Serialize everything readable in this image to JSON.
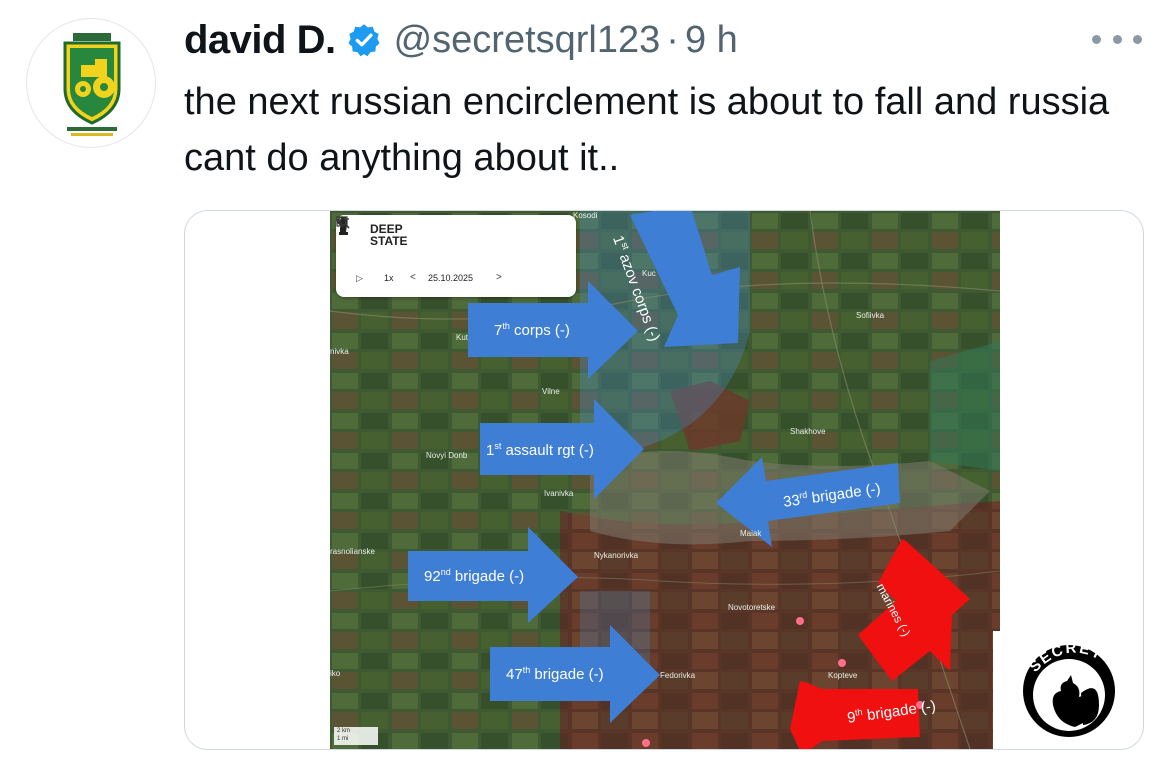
{
  "tweet": {
    "author_name": "david D.",
    "handle": "@secretsqrl123",
    "separator": "·",
    "time": "9 h",
    "text": "the next russian encirclement is about to fall and russia cant do anything about it..",
    "avatar_icon": "tractor-shield-icon",
    "verified_icon": "verified-badge-icon",
    "more_icon": "more-dots-icon"
  },
  "map": {
    "panel": {
      "title_line1": "DEEP",
      "title_line2": "STATE",
      "play": "▷",
      "speed": "1x",
      "prev": "<",
      "date": "25.10.2025",
      "next": ">"
    },
    "towns": {
      "kosodi": "Kosodi",
      "kuc": "Kuc",
      "kut": "Kut",
      "nivka": "nivka",
      "vilne": "Vilne",
      "sofiivka": "Sofiivka",
      "shakhove": "Shakhove",
      "novyi_donb": "Novyi Donb",
      "ivanivka": "Ivanivka",
      "krasnolianske": "rasnolianske",
      "mykanorivka": "Nykanorivka",
      "maiak": "Maiak",
      "novotoretske": "Novotoretske",
      "fedorivka": "Fedorivka",
      "kopteve": "Kopteve",
      "iko": "iko"
    },
    "scale": {
      "km": "2 km",
      "mi": "1 mi"
    },
    "arrows": {
      "azov": {
        "sup": "st",
        "pre": "1",
        "text": " azov corps (-)"
      },
      "corps7": {
        "pre": "7",
        "sup": "th",
        "text": " corps (-)"
      },
      "assault": {
        "pre": "1",
        "sup": "st",
        "text": " assault rgt  (-)"
      },
      "b33": {
        "pre": "33",
        "sup": "rd",
        "text": " brigade (-)"
      },
      "b92": {
        "pre": "92",
        "sup": "nd",
        "text": " brigade (-)"
      },
      "marines": {
        "text": "marines (-)"
      },
      "b47": {
        "pre": "47",
        "sup": "th",
        "text": " brigade (-)"
      },
      "b9": {
        "pre": "9",
        "sup": "th",
        "text": " brigade (-)"
      }
    },
    "colors": {
      "blue_arrow": "#3e7ed4",
      "red_arrow": "#f01010"
    }
  },
  "watermark": {
    "text": "SECRET",
    "icon": "squirrel-icon"
  }
}
